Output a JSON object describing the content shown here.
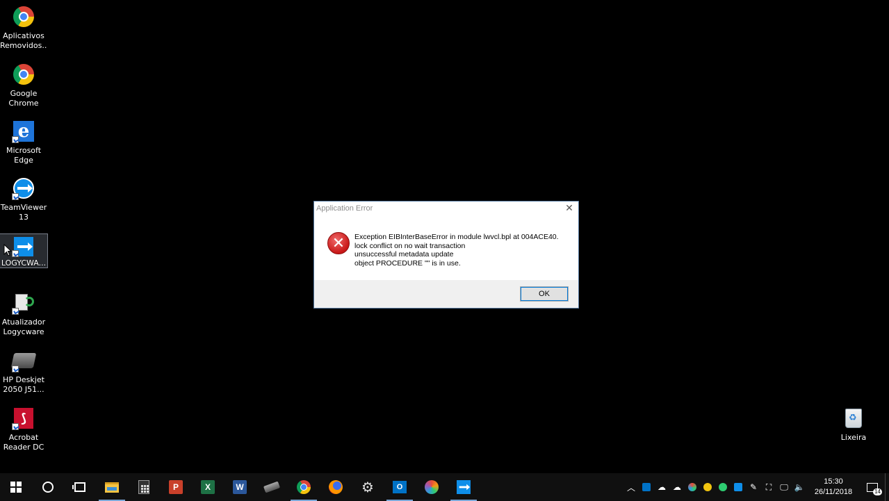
{
  "desktop": {
    "icons": [
      {
        "label": "Aplicativos\nRemovidos..."
      },
      {
        "label": "Google\nChrome"
      },
      {
        "label": "Microsoft\nEdge"
      },
      {
        "label": "TeamViewer\n13"
      },
      {
        "label": "LOGYCWA..."
      },
      {
        "label": "Atualizador\nLogycware"
      },
      {
        "label": "HP Deskjet\n2050 J51..."
      },
      {
        "label": "Acrobat\nReader DC"
      }
    ],
    "recycle_bin": {
      "label": "Lixeira"
    }
  },
  "dialog": {
    "title": "Application Error",
    "close_glyph": "✕",
    "message_lines": [
      "Exception EIBInterBaseError in module lwvcl.bpl at 004ACE40.",
      "lock conflict on no wait transaction",
      "unsuccessful metadata update",
      "object PROCEDURE \"\" is in use."
    ],
    "ok_label": "OK",
    "error_glyph": "✕"
  },
  "taskbar": {
    "apps": [
      {
        "name": "file-explorer"
      },
      {
        "name": "calculator"
      },
      {
        "name": "powerpoint",
        "letter": "P"
      },
      {
        "name": "excel",
        "letter": "X"
      },
      {
        "name": "word",
        "letter": "W"
      },
      {
        "name": "pen-tool"
      },
      {
        "name": "chrome"
      },
      {
        "name": "firefox"
      },
      {
        "name": "settings"
      },
      {
        "name": "outlook",
        "letter": "O"
      },
      {
        "name": "colorful-app"
      },
      {
        "name": "teamviewer"
      }
    ],
    "tray": {
      "time": "15:30",
      "date": "26/11/2018",
      "notification_count": "14"
    }
  },
  "colors": {
    "desktop_bg": "#000000",
    "taskbar_bg": "#101010",
    "dialog_footer": "#f0f0f0",
    "error_red": "#c81717",
    "accent": "#0078d7"
  }
}
